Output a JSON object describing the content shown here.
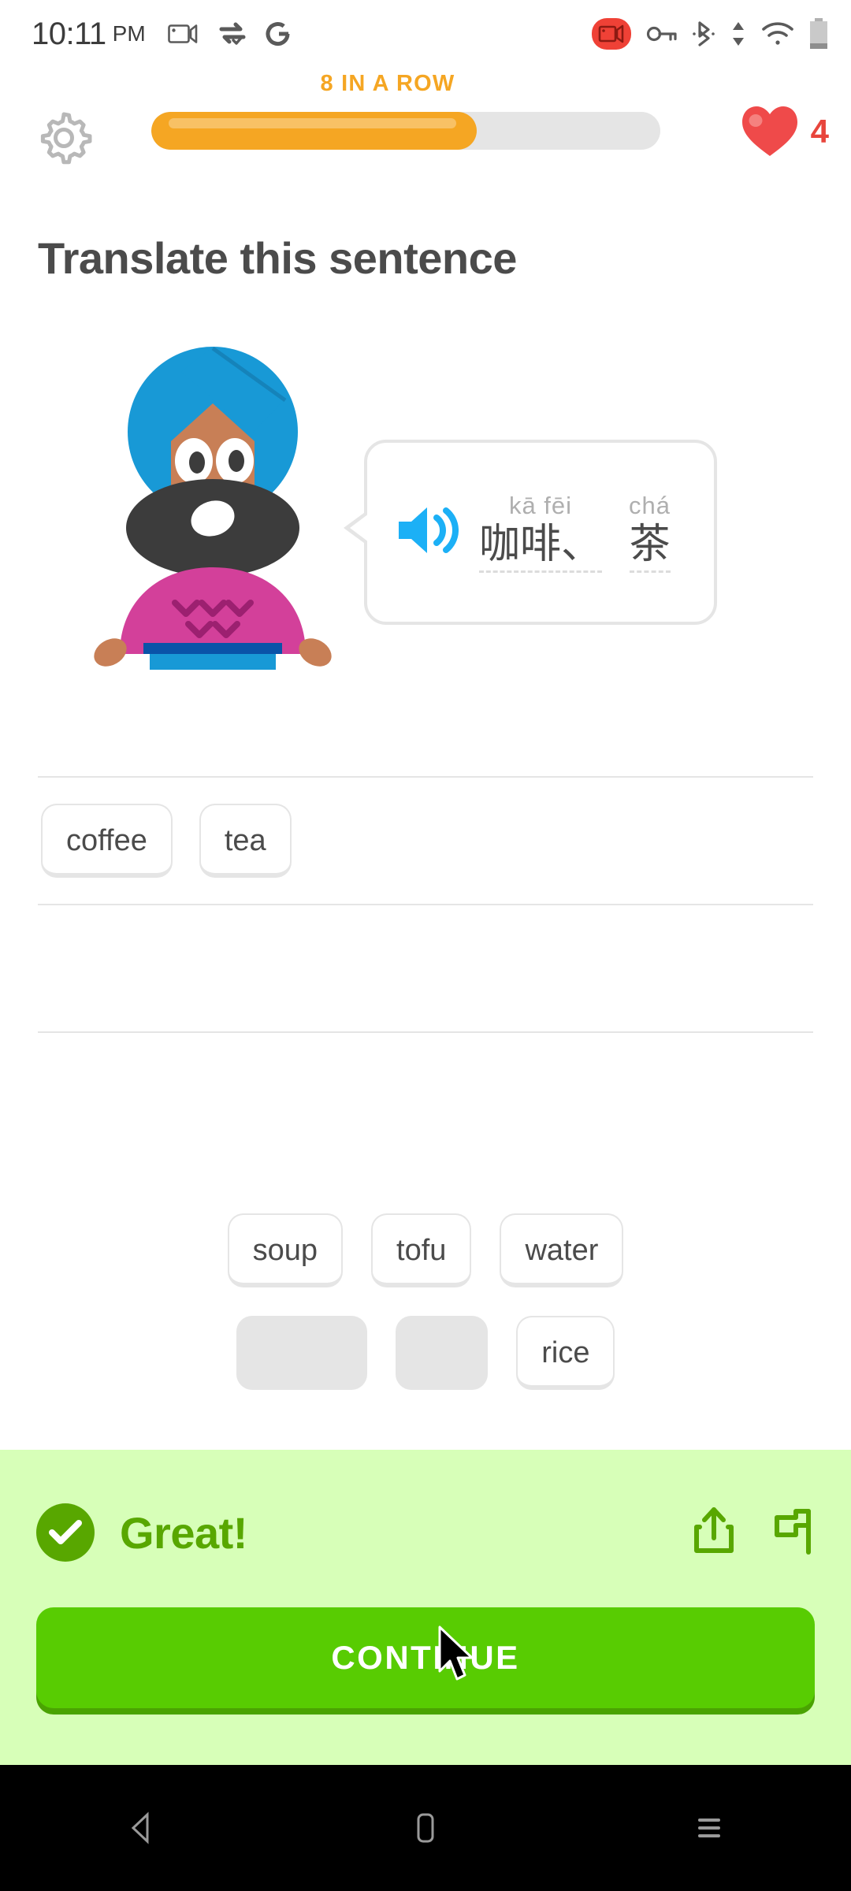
{
  "status_bar": {
    "time": "10:11",
    "ampm": "PM",
    "left_icons": [
      "screen-cast-icon",
      "vpn-sync-icon",
      "google-icon"
    ],
    "right_icons": [
      "screen-record-icon",
      "vpn-key-icon",
      "bluetooth-icon",
      "data-transfer-icon",
      "wifi-icon",
      "battery-icon"
    ]
  },
  "top_bar": {
    "settings_icon": "gear-icon",
    "streak_label": "8 IN A ROW",
    "progress_percent": 64,
    "progress_color": "#f5a623",
    "hearts_icon": "heart-icon",
    "hearts_count": "4",
    "hearts_color": "#e8453c"
  },
  "exercise": {
    "title": "Translate this sentence",
    "character": "vikram-character",
    "speaker_icon": "speaker-icon",
    "speaker_color": "#1cb0f6",
    "words": [
      {
        "pinyin": "kā fēi",
        "hanzi": "咖啡、"
      },
      {
        "pinyin": "chá",
        "hanzi": "茶"
      }
    ]
  },
  "answer": {
    "placed_tiles": [
      "coffee",
      "tea"
    ],
    "empty_line_count": 2
  },
  "word_bank": {
    "rows": [
      [
        {
          "label": "soup",
          "used": false
        },
        {
          "label": "tofu",
          "used": false
        },
        {
          "label": "water",
          "used": false
        }
      ],
      [
        {
          "label": "coffee",
          "used": true
        },
        {
          "label": "tea",
          "used": true
        },
        {
          "label": "rice",
          "used": false
        }
      ]
    ]
  },
  "footer": {
    "result_text": "Great!",
    "check_icon": "check-circle-icon",
    "share_icon": "share-icon",
    "report_icon": "flag-report-icon",
    "accent_color": "#58a700",
    "background_color": "#d7ffb8",
    "continue_label": "CONTINUE",
    "continue_color": "#58cc02"
  },
  "nav_bar": {
    "back": "back-triangle-icon",
    "home": "home-rect-icon",
    "recents": "recents-lines-icon"
  }
}
